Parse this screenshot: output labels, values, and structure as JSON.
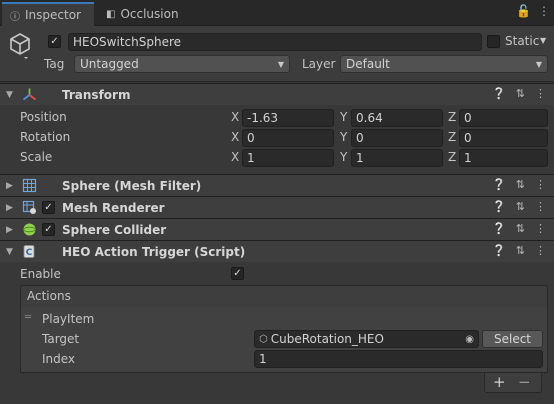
{
  "tabs": [
    {
      "label": "Inspector",
      "icon": "info-icon"
    },
    {
      "label": "Occlusion",
      "icon": "occlusion-icon"
    }
  ],
  "header": {
    "object_name": "HEOSwitchSphere",
    "active": true,
    "static_label": "Static",
    "tag_label": "Tag",
    "tag_value": "Untagged",
    "layer_label": "Layer",
    "layer_value": "Default"
  },
  "transform": {
    "title": "Transform",
    "rows": [
      {
        "label": "Position",
        "x": "-1.63",
        "y": "0.64",
        "z": "0"
      },
      {
        "label": "Rotation",
        "x": "0",
        "y": "0",
        "z": "0"
      },
      {
        "label": "Scale",
        "x": "1",
        "y": "1",
        "z": "1"
      }
    ],
    "axis_labels": {
      "x": "X",
      "y": "Y",
      "z": "Z"
    }
  },
  "components": [
    {
      "title": "Sphere (Mesh Filter)",
      "checkbox": false
    },
    {
      "title": "Mesh Renderer",
      "checkbox": true
    },
    {
      "title": "Sphere Collider",
      "checkbox": true
    }
  ],
  "script": {
    "title": "HEO Action Trigger (Script)",
    "enable_label": "Enable",
    "enable_checked": true,
    "actions_label": "Actions",
    "item_label": "PlayItem",
    "target_label": "Target",
    "target_value": "CubeRotation_HEO",
    "select_label": "Select",
    "index_label": "Index",
    "index_value": "1",
    "add_label": "+",
    "remove_label": "−"
  }
}
